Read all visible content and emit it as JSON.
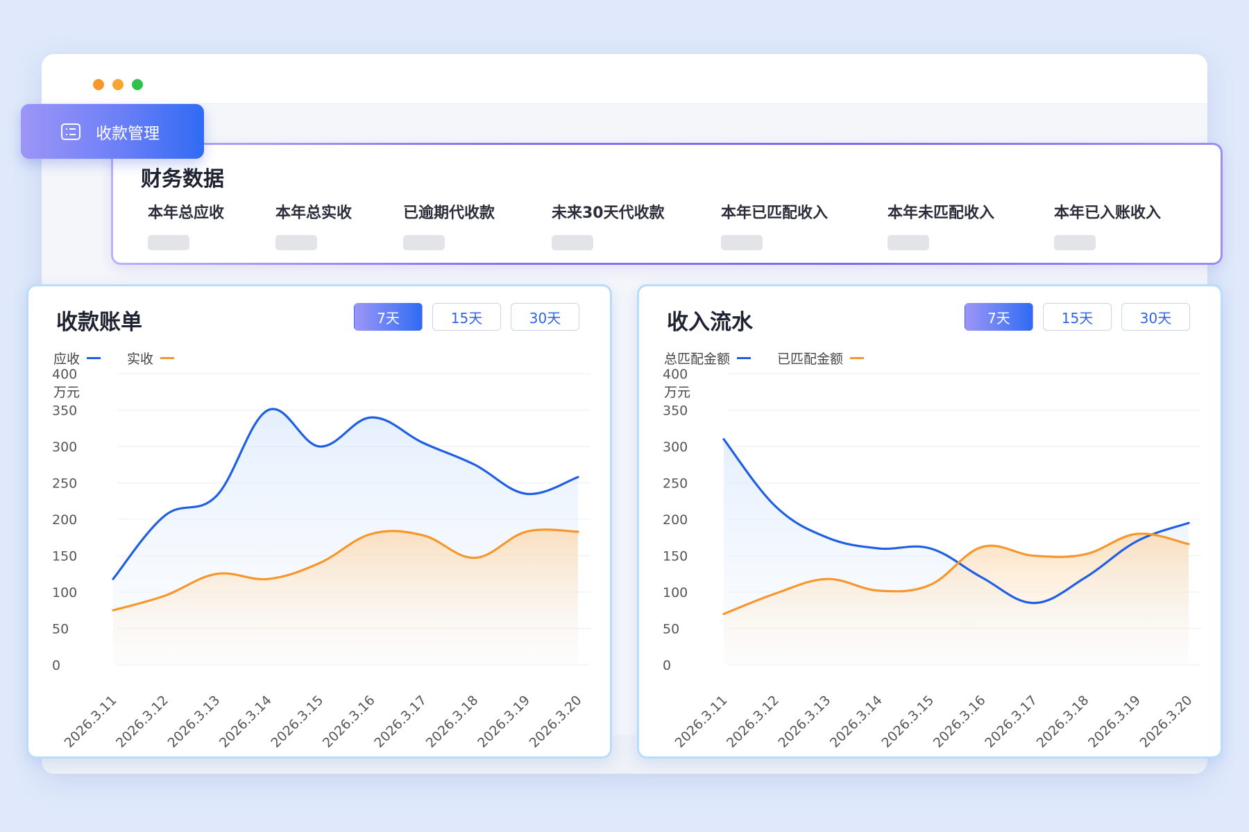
{
  "badge": {
    "label": "收款管理",
    "icon": "list-icon"
  },
  "finance": {
    "title": "财务数据",
    "items": [
      {
        "label": "本年总应收"
      },
      {
        "label": "本年总实收"
      },
      {
        "label": "已逾期代收款"
      },
      {
        "label": "未来30天代收款"
      },
      {
        "label": "本年已匹配收入"
      },
      {
        "label": "本年未匹配收入"
      },
      {
        "label": "本年已入账收入"
      }
    ]
  },
  "colors": {
    "blue": "#1e5fe3",
    "orange": "#f7962b",
    "accent": "#2f6bf3"
  },
  "chart_data": [
    {
      "type": "area",
      "title": "收款账单",
      "tabs": [
        "7天",
        "15天",
        "30天"
      ],
      "active_tab": 0,
      "unit": "万元",
      "yticks": [
        0,
        50,
        100,
        150,
        200,
        250,
        300,
        350,
        400
      ],
      "ylim": [
        0,
        400
      ],
      "grid": true,
      "categories": [
        "2026.3.11",
        "2026.3.12",
        "2026.3.13",
        "2026.3.14",
        "2026.3.15",
        "2026.3.16",
        "2026.3.17",
        "2026.3.18",
        "2026.3.19",
        "2026.3.20"
      ],
      "series": [
        {
          "name": "应收",
          "color": "#1e5fe3",
          "values": [
            118,
            205,
            232,
            350,
            300,
            340,
            305,
            275,
            235,
            258
          ]
        },
        {
          "name": "实收",
          "color": "#f7962b",
          "values": [
            75,
            95,
            125,
            118,
            140,
            180,
            178,
            147,
            183,
            183
          ]
        }
      ]
    },
    {
      "type": "area",
      "title": "收入流水",
      "tabs": [
        "7天",
        "15天",
        "30天"
      ],
      "active_tab": 0,
      "unit": "万元",
      "yticks": [
        0,
        50,
        100,
        150,
        200,
        250,
        300,
        350,
        400
      ],
      "ylim": [
        0,
        400
      ],
      "grid": true,
      "categories": [
        "2026.3.11",
        "2026.3.12",
        "2026.3.13",
        "2026.3.14",
        "2026.3.15",
        "2026.3.16",
        "2026.3.17",
        "2026.3.18",
        "2026.3.19",
        "2026.3.20"
      ],
      "series": [
        {
          "name": "总匹配金额",
          "color": "#1e5fe3",
          "values": [
            310,
            218,
            175,
            160,
            160,
            120,
            85,
            120,
            170,
            195
          ]
        },
        {
          "name": "已匹配金额",
          "color": "#f7962b",
          "values": [
            70,
            98,
            118,
            102,
            110,
            162,
            150,
            152,
            180,
            166
          ]
        }
      ]
    }
  ]
}
